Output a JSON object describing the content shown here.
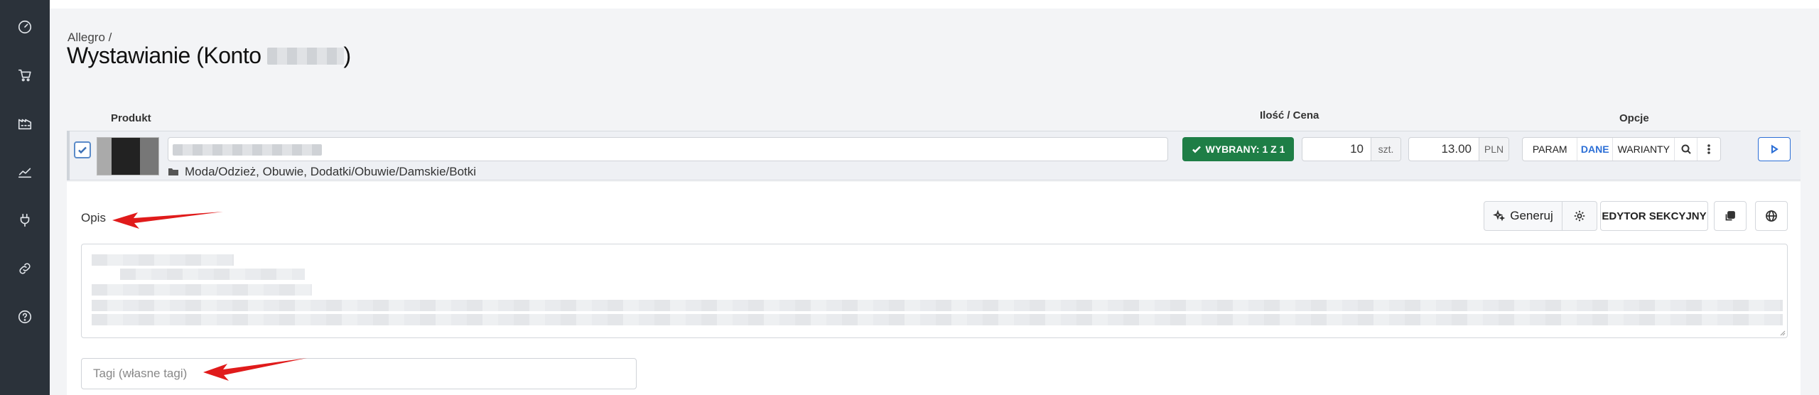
{
  "breadcrumb": "Allegro /",
  "page_title": "Wystawianie (Konto",
  "page_title_end": ")",
  "columns": {
    "product": "Produkt",
    "qty_price": "Ilość / Cena",
    "options": "Opcje"
  },
  "row": {
    "category": "Moda/Odzież, Obuwie, Dodatki/Obuwie/Damskie/Botki",
    "selected_label": "WYBRANY: 1 Z 1",
    "quantity": "10",
    "quantity_unit": "szt.",
    "price": "13.00",
    "currency": "PLN",
    "options": {
      "param": "PARAM",
      "dane": "DANE",
      "warianty": "WARIANTY"
    }
  },
  "description": {
    "label": "Opis",
    "generate_label": "Generuj",
    "section_editor_label": "EDYTOR SEKCYJNY"
  },
  "tags": {
    "placeholder": "Tagi (własne tagi)"
  },
  "colors": {
    "sidebar": "#2b323a",
    "accent_green": "#1e7e46",
    "accent_blue": "#2c6fd6",
    "annotation_red": "#e01b1b"
  },
  "icons": {
    "sidebar": [
      "dashboard-icon",
      "cart-icon",
      "warehouse-icon",
      "chart-icon",
      "plug-icon",
      "link-icon",
      "help-icon"
    ]
  }
}
